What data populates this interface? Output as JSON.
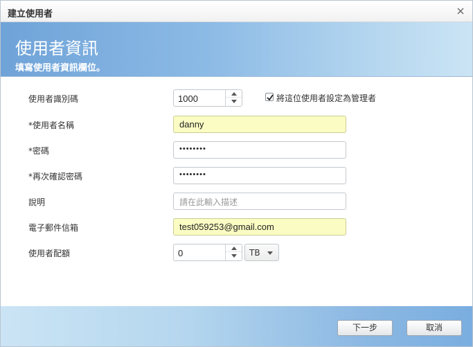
{
  "dialog": {
    "title": "建立使用者"
  },
  "banner": {
    "heading": "使用者資訊",
    "subheading": "填寫使用者資訊欄位。"
  },
  "form": {
    "user_id": {
      "label": "使用者識別碼",
      "value": "1000"
    },
    "admin_checkbox": {
      "label": "將這位使用者設定為管理者",
      "checked": true
    },
    "username": {
      "label": "*使用者名稱",
      "value": "danny"
    },
    "password": {
      "label": "*密碼",
      "value": "••••••••"
    },
    "confirm_password": {
      "label": "*再次確認密碼",
      "value": "••••••••"
    },
    "description": {
      "label": "說明",
      "placeholder": "請在此輸入描述"
    },
    "email": {
      "label": "電子郵件信箱",
      "value": "test059253@gmail.com"
    },
    "quota": {
      "label": "使用者配額",
      "value": "0",
      "unit": "TB"
    }
  },
  "footer": {
    "next_label": "下一步",
    "cancel_label": "取消"
  },
  "colors": {
    "banner_accent": "#6fa3d8",
    "highlight_field": "#fbfcc3"
  },
  "icons": {
    "close": "close-icon",
    "check": "check-icon",
    "spin_up": "spin-up-icon",
    "spin_down": "spin-down-icon",
    "dropdown": "chevron-down-icon"
  }
}
